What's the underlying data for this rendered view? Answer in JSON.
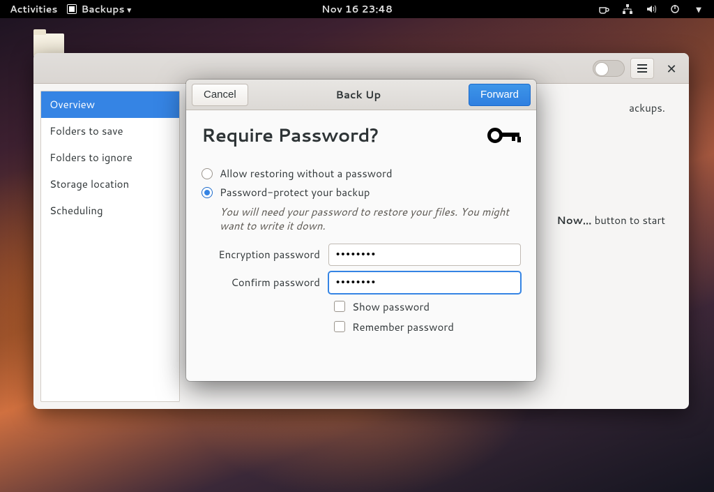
{
  "topbar": {
    "activities": "Activities",
    "app_name": "Backups",
    "datetime": "Nov 16  23:48"
  },
  "main_window": {
    "sidebar": {
      "items": [
        {
          "label": "Overview",
          "active": true
        },
        {
          "label": "Folders to save"
        },
        {
          "label": "Folders to ignore"
        },
        {
          "label": "Storage location"
        },
        {
          "label": "Scheduling"
        }
      ]
    },
    "content": {
      "line1_suffix": "ackups.",
      "line2_suffix": "Now…",
      "line2_tail": " button to start"
    }
  },
  "dialog": {
    "cancel_label": "Cancel",
    "title": "Back Up",
    "forward_label": "Forward",
    "heading": "Require Password?",
    "radio_allow": "Allow restoring without a password",
    "radio_protect": "Password-protect your backup",
    "hint": "You will need your password to restore your files. You might want to write it down.",
    "enc_label": "Encryption password",
    "confirm_label": "Confirm password",
    "enc_value": "••••••••",
    "confirm_value": "••••••••",
    "show_pw": "Show password",
    "remember_pw": "Remember password"
  },
  "icons": {
    "coffee": "coffee-icon",
    "network": "network-icon",
    "volume": "volume-icon",
    "power": "power-icon",
    "caret": "caret-icon"
  }
}
